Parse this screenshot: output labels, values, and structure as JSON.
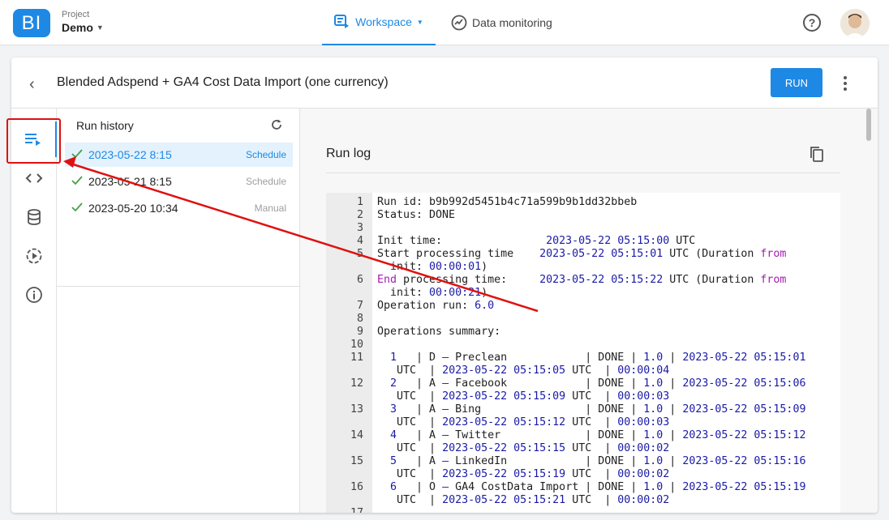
{
  "header": {
    "logo_text": "BI",
    "project_label": "Project",
    "project_name": "Demo",
    "nav": [
      {
        "label": "Workspace",
        "active": true
      },
      {
        "label": "Data monitoring",
        "active": false
      }
    ]
  },
  "pipeline": {
    "title": "Blended Adspend + GA4 Cost Data Import (one currency)",
    "run_label": "RUN"
  },
  "history": {
    "title": "Run history",
    "runs": [
      {
        "date": "2023-05-22 8:15",
        "type": "Schedule",
        "selected": true
      },
      {
        "date": "2023-05-21 8:15",
        "type": "Schedule",
        "selected": false
      },
      {
        "date": "2023-05-20 10:34",
        "type": "Manual",
        "selected": false
      }
    ]
  },
  "log": {
    "title": "Run log",
    "lines": [
      {
        "n": "1",
        "segs": [
          [
            "Run id: b9b992d5451b4c71a599b9b1dd32bbeb",
            ""
          ]
        ]
      },
      {
        "n": "2",
        "segs": [
          [
            "Status: DONE",
            ""
          ]
        ]
      },
      {
        "n": "3",
        "segs": [
          [
            "",
            ""
          ]
        ]
      },
      {
        "n": "4",
        "segs": [
          [
            "Init time:                ",
            ""
          ],
          [
            "2023-05-22",
            "blue"
          ],
          [
            " ",
            ""
          ],
          [
            "05:15:00",
            "blue"
          ],
          [
            " UTC",
            ""
          ]
        ]
      },
      {
        "n": "5",
        "segs": [
          [
            "Start processing time    ",
            ""
          ],
          [
            "2023-05-22",
            "blue"
          ],
          [
            " ",
            ""
          ],
          [
            "05:15:01",
            "blue"
          ],
          [
            " UTC (Duration ",
            ""
          ],
          [
            "from",
            "purp"
          ]
        ]
      },
      {
        "n": "",
        "segs": [
          [
            "  init: ",
            ""
          ],
          [
            "00:00:01",
            "blue"
          ],
          [
            ")",
            ""
          ]
        ]
      },
      {
        "n": "6",
        "segs": [
          [
            "End",
            "purp"
          ],
          [
            " processing time:     ",
            ""
          ],
          [
            "2023-05-22",
            "blue"
          ],
          [
            " ",
            ""
          ],
          [
            "05:15:22",
            "blue"
          ],
          [
            " UTC (Duration ",
            ""
          ],
          [
            "from",
            "purp"
          ]
        ]
      },
      {
        "n": "",
        "segs": [
          [
            "  init: ",
            ""
          ],
          [
            "00:00:21",
            "blue"
          ],
          [
            ")",
            ""
          ]
        ]
      },
      {
        "n": "7",
        "segs": [
          [
            "Operation run: ",
            ""
          ],
          [
            "6.0",
            "blue"
          ]
        ]
      },
      {
        "n": "8",
        "segs": [
          [
            "",
            ""
          ]
        ]
      },
      {
        "n": "9",
        "segs": [
          [
            "Operations summary:",
            ""
          ]
        ]
      },
      {
        "n": "10",
        "segs": [
          [
            "",
            ""
          ]
        ]
      },
      {
        "n": "11",
        "segs": [
          [
            "  ",
            ""
          ],
          [
            "1",
            "blue"
          ],
          [
            "   | D ",
            ""
          ],
          [
            "–",
            "blue"
          ],
          [
            " Preclean            | DONE | ",
            ""
          ],
          [
            "1.0",
            "blue"
          ],
          [
            " | ",
            ""
          ],
          [
            "2023-05-22",
            "blue"
          ],
          [
            " ",
            ""
          ],
          [
            "05:15:01",
            "blue"
          ]
        ]
      },
      {
        "n": "",
        "segs": [
          [
            "   UTC  | ",
            ""
          ],
          [
            "2023-05-22",
            "blue"
          ],
          [
            " ",
            ""
          ],
          [
            "05:15:05",
            "blue"
          ],
          [
            " UTC  | ",
            ""
          ],
          [
            "00:00:04",
            "blue"
          ]
        ]
      },
      {
        "n": "12",
        "segs": [
          [
            "  ",
            ""
          ],
          [
            "2",
            "blue"
          ],
          [
            "   | A ",
            ""
          ],
          [
            "–",
            "blue"
          ],
          [
            " Facebook            | DONE | ",
            ""
          ],
          [
            "1.0",
            "blue"
          ],
          [
            " | ",
            ""
          ],
          [
            "2023-05-22",
            "blue"
          ],
          [
            " ",
            ""
          ],
          [
            "05:15:06",
            "blue"
          ]
        ]
      },
      {
        "n": "",
        "segs": [
          [
            "   UTC  | ",
            ""
          ],
          [
            "2023-05-22",
            "blue"
          ],
          [
            " ",
            ""
          ],
          [
            "05:15:09",
            "blue"
          ],
          [
            " UTC  | ",
            ""
          ],
          [
            "00:00:03",
            "blue"
          ]
        ]
      },
      {
        "n": "13",
        "segs": [
          [
            "  ",
            ""
          ],
          [
            "3",
            "blue"
          ],
          [
            "   | A ",
            ""
          ],
          [
            "–",
            "blue"
          ],
          [
            " Bing                | DONE | ",
            ""
          ],
          [
            "1.0",
            "blue"
          ],
          [
            " | ",
            ""
          ],
          [
            "2023-05-22",
            "blue"
          ],
          [
            " ",
            ""
          ],
          [
            "05:15:09",
            "blue"
          ]
        ]
      },
      {
        "n": "",
        "segs": [
          [
            "   UTC  | ",
            ""
          ],
          [
            "2023-05-22",
            "blue"
          ],
          [
            " ",
            ""
          ],
          [
            "05:15:12",
            "blue"
          ],
          [
            " UTC  | ",
            ""
          ],
          [
            "00:00:03",
            "blue"
          ]
        ]
      },
      {
        "n": "14",
        "segs": [
          [
            "  ",
            ""
          ],
          [
            "4",
            "blue"
          ],
          [
            "   | A ",
            ""
          ],
          [
            "–",
            "blue"
          ],
          [
            " Twitter             | DONE | ",
            ""
          ],
          [
            "1.0",
            "blue"
          ],
          [
            " | ",
            ""
          ],
          [
            "2023-05-22",
            "blue"
          ],
          [
            " ",
            ""
          ],
          [
            "05:15:12",
            "blue"
          ]
        ]
      },
      {
        "n": "",
        "segs": [
          [
            "   UTC  | ",
            ""
          ],
          [
            "2023-05-22",
            "blue"
          ],
          [
            " ",
            ""
          ],
          [
            "05:15:15",
            "blue"
          ],
          [
            " UTC  | ",
            ""
          ],
          [
            "00:00:02",
            "blue"
          ]
        ]
      },
      {
        "n": "15",
        "segs": [
          [
            "  ",
            ""
          ],
          [
            "5",
            "blue"
          ],
          [
            "   | A ",
            ""
          ],
          [
            "–",
            "blue"
          ],
          [
            " LinkedIn            | DONE | ",
            ""
          ],
          [
            "1.0",
            "blue"
          ],
          [
            " | ",
            ""
          ],
          [
            "2023-05-22",
            "blue"
          ],
          [
            " ",
            ""
          ],
          [
            "05:15:16",
            "blue"
          ]
        ]
      },
      {
        "n": "",
        "segs": [
          [
            "   UTC  | ",
            ""
          ],
          [
            "2023-05-22",
            "blue"
          ],
          [
            " ",
            ""
          ],
          [
            "05:15:19",
            "blue"
          ],
          [
            " UTC  | ",
            ""
          ],
          [
            "00:00:02",
            "blue"
          ]
        ]
      },
      {
        "n": "16",
        "segs": [
          [
            "  ",
            ""
          ],
          [
            "6",
            "blue"
          ],
          [
            "   | O ",
            ""
          ],
          [
            "–",
            "blue"
          ],
          [
            " GA4 CostData Import | DONE | ",
            ""
          ],
          [
            "1.0",
            "blue"
          ],
          [
            " | ",
            ""
          ],
          [
            "2023-05-22",
            "blue"
          ],
          [
            " ",
            ""
          ],
          [
            "05:15:19",
            "blue"
          ]
        ]
      },
      {
        "n": "",
        "segs": [
          [
            "   UTC  | ",
            ""
          ],
          [
            "2023-05-22",
            "blue"
          ],
          [
            " ",
            ""
          ],
          [
            "05:15:21",
            "blue"
          ],
          [
            " UTC  | ",
            ""
          ],
          [
            "00:00:02",
            "blue"
          ]
        ]
      },
      {
        "n": "17",
        "segs": [
          [
            "",
            ""
          ]
        ]
      }
    ]
  },
  "colors": {
    "accent": "#1e88e5",
    "annotation": "#e01010",
    "code_blue": "#1a1aa6",
    "code_purple": "#a31dad"
  }
}
